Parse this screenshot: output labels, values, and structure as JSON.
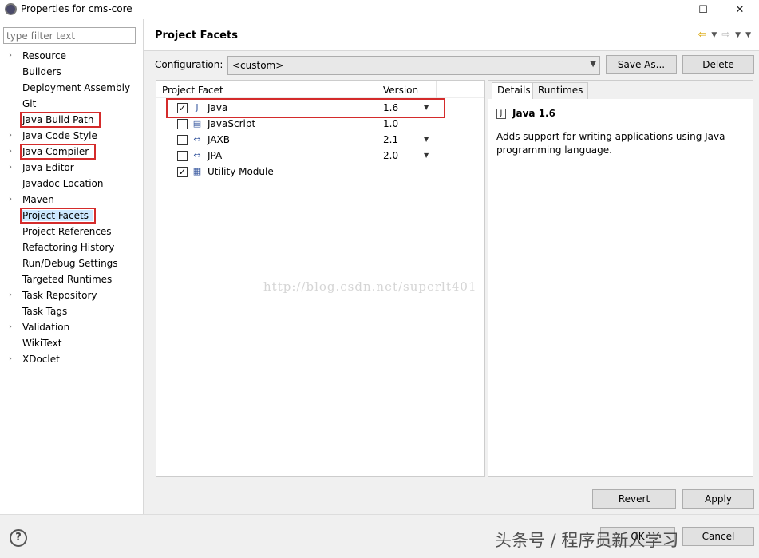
{
  "window": {
    "title": "Properties for cms-core",
    "minimize": "—",
    "maximize": "☐",
    "close": "✕"
  },
  "filter": {
    "placeholder": "type filter text"
  },
  "nav": {
    "items": [
      {
        "label": "Resource",
        "expandable": true
      },
      {
        "label": "Builders",
        "expandable": false
      },
      {
        "label": "Deployment Assembly",
        "expandable": false
      },
      {
        "label": "Git",
        "expandable": false
      },
      {
        "label": "Java Build Path",
        "expandable": false,
        "highlighted": true
      },
      {
        "label": "Java Code Style",
        "expandable": true
      },
      {
        "label": "Java Compiler",
        "expandable": true,
        "highlighted": true
      },
      {
        "label": "Java Editor",
        "expandable": true
      },
      {
        "label": "Javadoc Location",
        "expandable": false
      },
      {
        "label": "Maven",
        "expandable": true
      },
      {
        "label": "Project Facets",
        "expandable": false,
        "highlighted": true,
        "selected": true
      },
      {
        "label": "Project References",
        "expandable": false
      },
      {
        "label": "Refactoring History",
        "expandable": false
      },
      {
        "label": "Run/Debug Settings",
        "expandable": false
      },
      {
        "label": "Targeted Runtimes",
        "expandable": false
      },
      {
        "label": "Task Repository",
        "expandable": true
      },
      {
        "label": "Task Tags",
        "expandable": false
      },
      {
        "label": "Validation",
        "expandable": true
      },
      {
        "label": "WikiText",
        "expandable": false
      },
      {
        "label": "XDoclet",
        "expandable": true
      }
    ]
  },
  "page": {
    "title": "Project Facets",
    "config_label": "Configuration:",
    "config_value": "<custom>",
    "save_as": "Save As...",
    "delete": "Delete"
  },
  "table": {
    "col_facet": "Project Facet",
    "col_version": "Version",
    "rows": [
      {
        "name": "Java",
        "version": "1.6",
        "checked": true,
        "dropdown": true,
        "icon": "java-icon"
      },
      {
        "name": "JavaScript",
        "version": "1.0",
        "checked": false,
        "dropdown": false,
        "icon": "document-icon"
      },
      {
        "name": "JAXB",
        "version": "2.1",
        "checked": false,
        "dropdown": true,
        "icon": "swap-icon"
      },
      {
        "name": "JPA",
        "version": "2.0",
        "checked": false,
        "dropdown": true,
        "icon": "swap-icon"
      },
      {
        "name": "Utility Module",
        "version": "",
        "checked": true,
        "dropdown": false,
        "icon": "module-icon"
      }
    ]
  },
  "details": {
    "tab_details": "Details",
    "tab_runtimes": "Runtimes",
    "title": "Java 1.6",
    "description": "Adds support for writing applications using Java programming language."
  },
  "footer": {
    "revert": "Revert",
    "apply": "Apply",
    "help": "?",
    "ok": "OK",
    "cancel": "Cancel"
  },
  "watermarks": {
    "url": "http://blog.csdn.net/superlt401",
    "corner": "头条号 / 程序员新人学习"
  },
  "colors": {
    "highlight_box": "#d42b2b",
    "selected_bg": "#cce8ff",
    "back_arrow": "#d9a400"
  }
}
